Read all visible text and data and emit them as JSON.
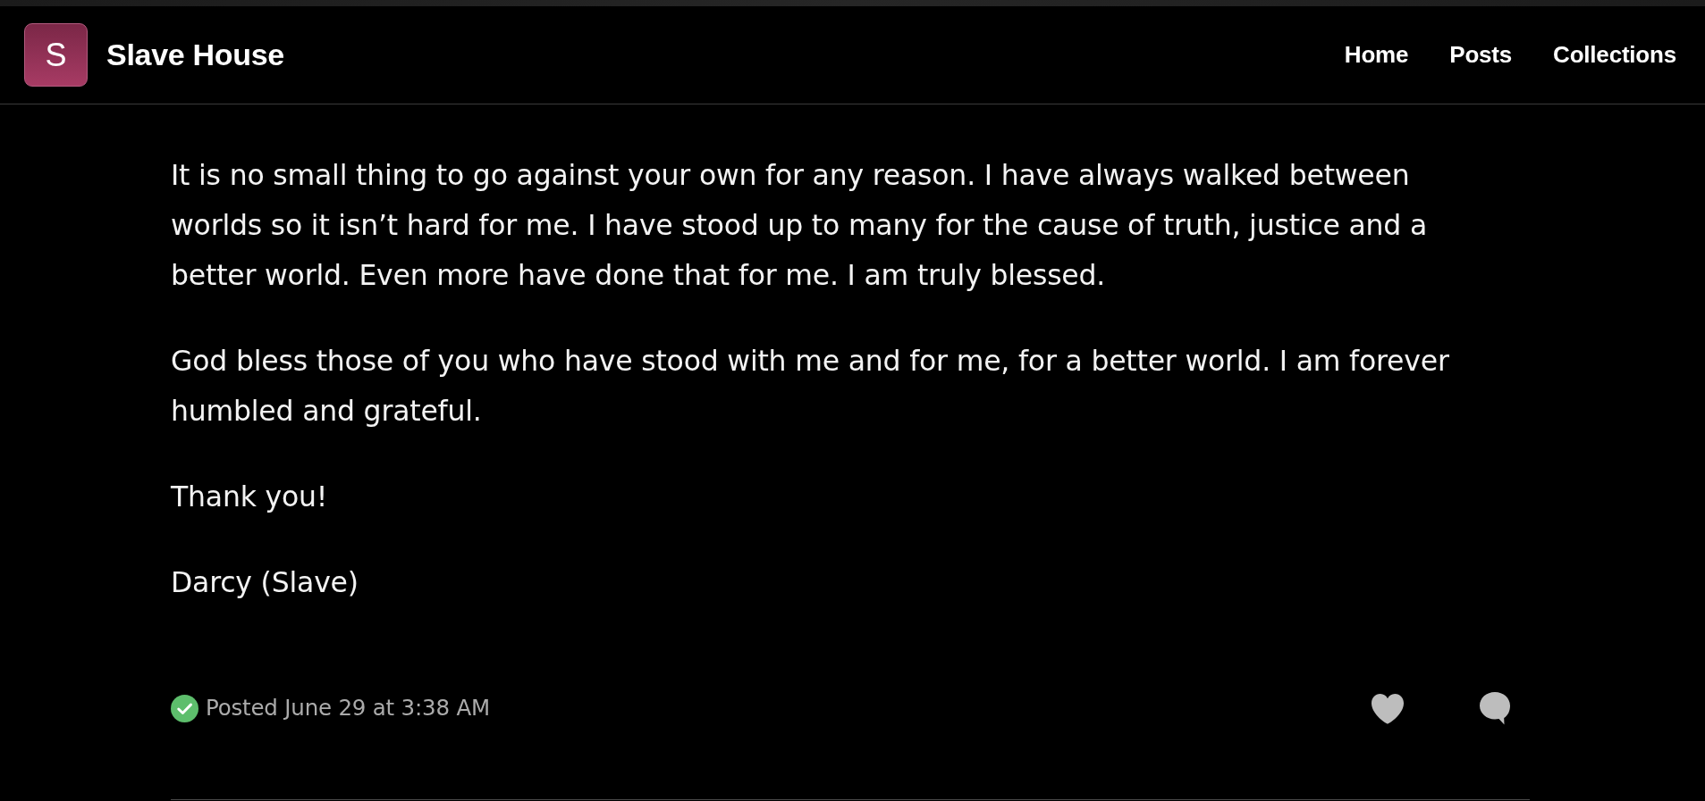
{
  "header": {
    "logo_letter": "S",
    "site_title": "Slave House",
    "nav": [
      {
        "label": "Home"
      },
      {
        "label": "Posts"
      },
      {
        "label": "Collections"
      }
    ]
  },
  "post": {
    "paragraphs": [
      "It is no small thing to go against your own for any reason. I have always walked between worlds so it isn’t hard for me. I have stood up to many for the cause of truth, justice and a better world. Even more have done that for me. I am truly blessed.",
      "God bless those of you who have stood with me and for me, for a better world. I am forever humbled and grateful.",
      "Thank you!",
      "Darcy (Slave)"
    ],
    "status": {
      "text": "Posted June 29 at 3:38 AM"
    }
  }
}
